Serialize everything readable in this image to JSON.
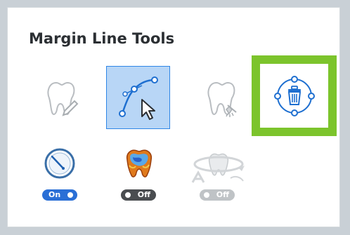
{
  "panel": {
    "title": "Margin Line Tools"
  },
  "tools": [
    {
      "name": "draw-margin-tool",
      "icon": "tooth-pencil-icon",
      "state": "disabled"
    },
    {
      "name": "edit-curve-tool",
      "icon": "curve-cursor-icon",
      "state": "selected"
    },
    {
      "name": "smooth-margin-tool",
      "icon": "tooth-brush-icon",
      "state": "disabled"
    },
    {
      "name": "delete-margin-tool",
      "icon": "trash-circle-icon",
      "state": "highlighted"
    }
  ],
  "toggles": [
    {
      "name": "auto-detect",
      "icon": "clock-dial-icon",
      "label": "On",
      "state": "on"
    },
    {
      "name": "color-map",
      "icon": "tooth-heatmap-icon",
      "label": "Off",
      "state": "off"
    },
    {
      "name": "rotate-view",
      "icon": "tooth-rotate-icon",
      "label": "Off",
      "state": "disabled"
    }
  ],
  "colors": {
    "accent": "#2f86e6",
    "selected_fill": "#b8d6f6",
    "highlight": "#7cc42c",
    "toggle_on": "#2a6fd6",
    "toggle_off": "#4a4d50"
  }
}
